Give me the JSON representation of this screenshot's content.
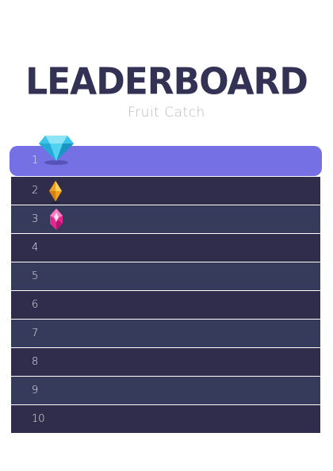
{
  "header": {
    "title": "LEADERBOARD",
    "subtitle": "Fruit Catch"
  },
  "leaderboard": {
    "rows": [
      {
        "rank": "1",
        "badge": "diamond-icon"
      },
      {
        "rank": "2",
        "badge": "orange-gem-icon"
      },
      {
        "rank": "3",
        "badge": "pink-gem-icon"
      },
      {
        "rank": "4"
      },
      {
        "rank": "5"
      },
      {
        "rank": "6"
      },
      {
        "rank": "7"
      },
      {
        "rank": "8"
      },
      {
        "rank": "9"
      },
      {
        "rank": "10"
      }
    ]
  },
  "colors": {
    "title": "#333154",
    "subtitle": "#b9b8c4",
    "highlight_row": "#7570e3",
    "row_dark": "#302c4c",
    "row_light": "#363a5b"
  }
}
